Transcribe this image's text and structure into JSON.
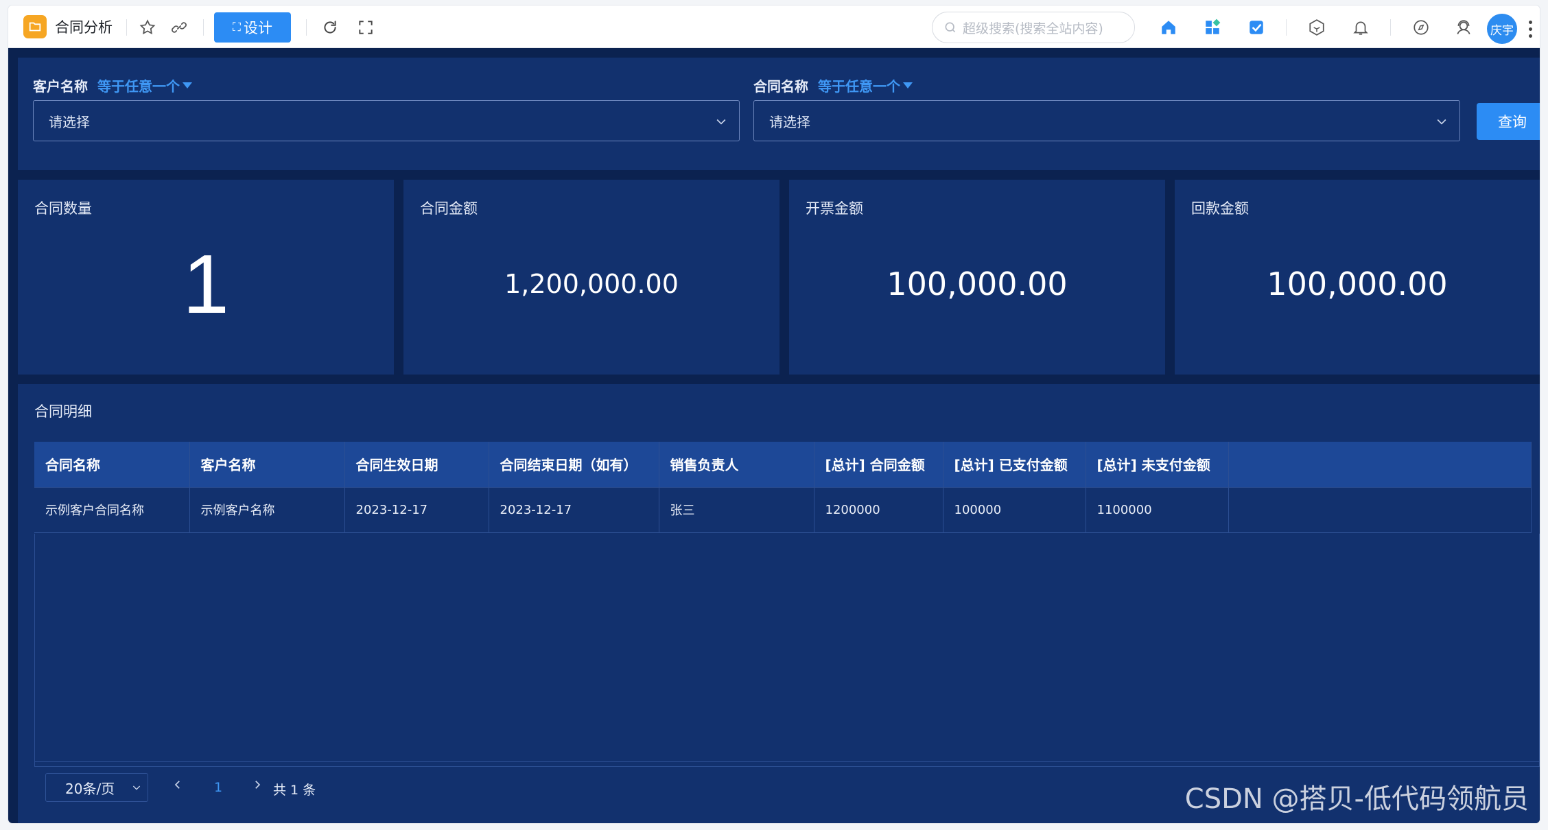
{
  "app": {
    "title": "合同分析",
    "design_label": "设计",
    "design_glyph": "⛶",
    "search_placeholder": "超级搜索(搜索全站内容)",
    "avatar_label": "庆宇"
  },
  "filters": [
    {
      "label": "客户名称",
      "mode": "等于任意一个",
      "placeholder": "请选择"
    },
    {
      "label": "合同名称",
      "mode": "等于任意一个",
      "placeholder": "请选择"
    }
  ],
  "query_label": "查询",
  "kpis": [
    {
      "label": "合同数量",
      "value": "1"
    },
    {
      "label": "合同金额",
      "value": "1,200,000.00"
    },
    {
      "label": "开票金额",
      "value": "100,000.00"
    },
    {
      "label": "回款金额",
      "value": "100,000.00"
    }
  ],
  "table": {
    "title": "合同明细",
    "columns": [
      "合同名称",
      "客户名称",
      "合同生效日期",
      "合同结束日期（如有）",
      "销售负责人",
      "[总计] 合同金额",
      "[总计] 已支付金额",
      "[总计] 未支付金额",
      ""
    ],
    "rows": [
      [
        "示例客户合同名称",
        "示例客户名称",
        "2023-12-17",
        "2023-12-17",
        "张三",
        "1200000",
        "100000",
        "1100000",
        ""
      ]
    ]
  },
  "pager": {
    "page_size": "20条/页",
    "current": "1",
    "total": "共 1 条"
  },
  "watermark": "CSDN @搭贝-低代码领航员",
  "colors": {
    "accent": "#2c8cf4",
    "dashboard_bg": "#0b2250",
    "panel_bg": "#12316e",
    "table_header": "#1d4897"
  }
}
